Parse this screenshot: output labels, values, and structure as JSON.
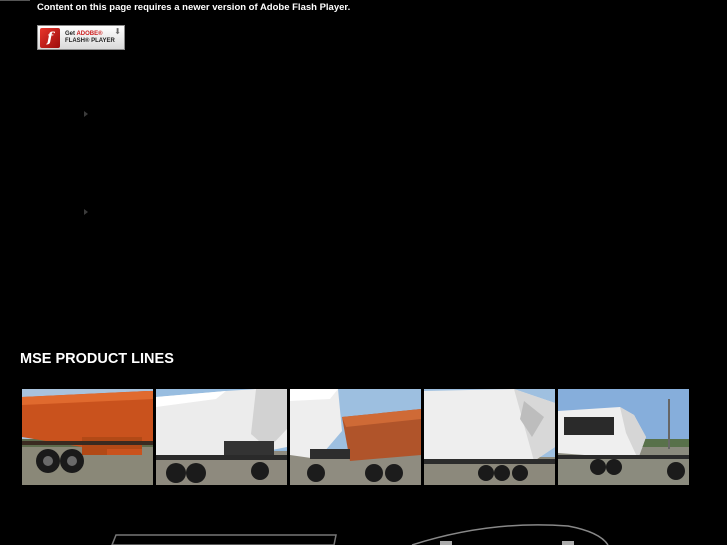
{
  "flash": {
    "notice": "Content on this page requires a newer version of Adobe Flash Player.",
    "badge": {
      "get": "Get",
      "adobe": "ADOBE®",
      "product": "FLASH® PLAYER",
      "logo_letter": "f"
    }
  },
  "products": {
    "heading": "MSE PRODUCT LINES",
    "items": [
      {
        "name": "orange spreader trailer"
      },
      {
        "name": "white belly dump trailer"
      },
      {
        "name": "white and orange trailer combination"
      },
      {
        "name": "white side dump trailer"
      },
      {
        "name": "white dump trailer on chassis"
      }
    ]
  },
  "colors": {
    "background": "#000000",
    "text": "#ffffff",
    "spreader_orange": "#c9521d",
    "trailer_white": "#eeeeee",
    "sky_blue": "#7fa6cf"
  }
}
